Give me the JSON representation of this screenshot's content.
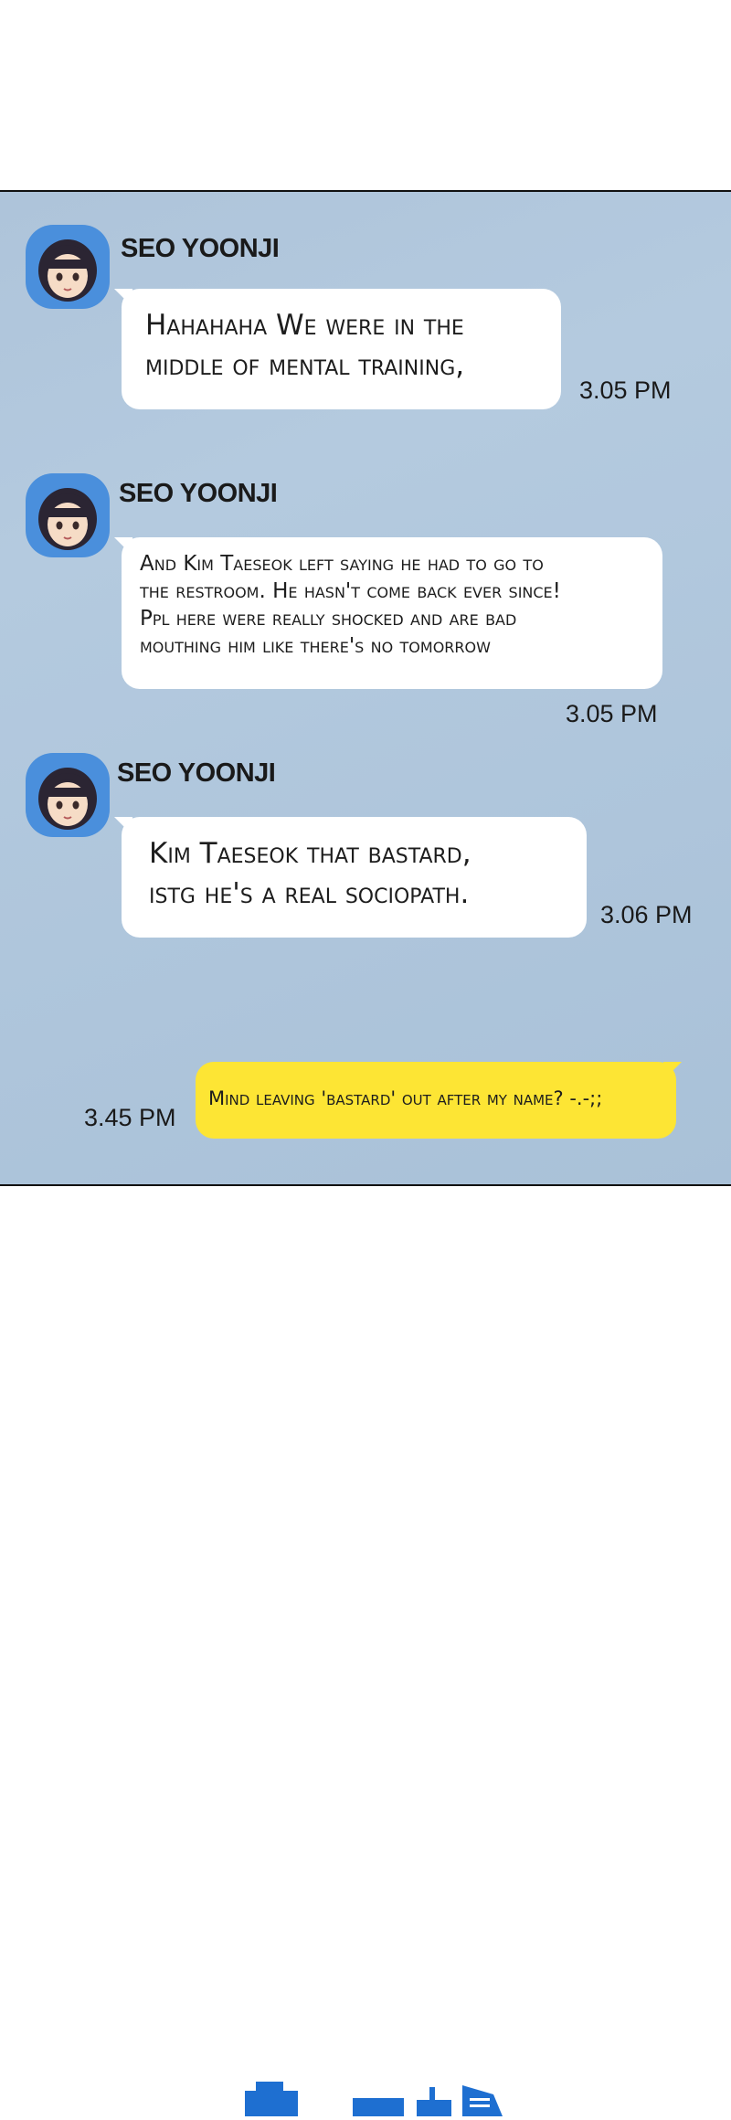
{
  "chat": {
    "messages": [
      {
        "sender": "SEO YOONJI",
        "text_lines": [
          "Hahahaha We were in the",
          "middle of mental training,"
        ],
        "time": "3.05 PM"
      },
      {
        "sender": "SEO YOONJI",
        "text_lines": [
          "And Kim Taeseok left saying he had to go to",
          "the restroom. He hasn't come back ever since!",
          "Ppl here were really shocked and are bad",
          "mouthing him like there's no tomorrow"
        ],
        "time": "3.05 PM"
      },
      {
        "sender": "SEO YOONJI",
        "text_lines": [
          "Kim Taeseok that bastard,",
          "istg he's a real sociopath."
        ],
        "time": "3.06 PM"
      },
      {
        "sender": "",
        "text_lines": [
          "Mind leaving 'bastard' out after my name? -.-;;"
        ],
        "time": "3.45 PM"
      }
    ]
  },
  "icons": {
    "avatar": "girl-avatar-icon",
    "footer": "logo-icon"
  },
  "colors": {
    "panel": "#b0c6dc",
    "avatar_ring": "#4a8fdc",
    "own_bubble": "#fde534",
    "other_bubble": "#ffffff",
    "logo": "#1e6fd1"
  }
}
